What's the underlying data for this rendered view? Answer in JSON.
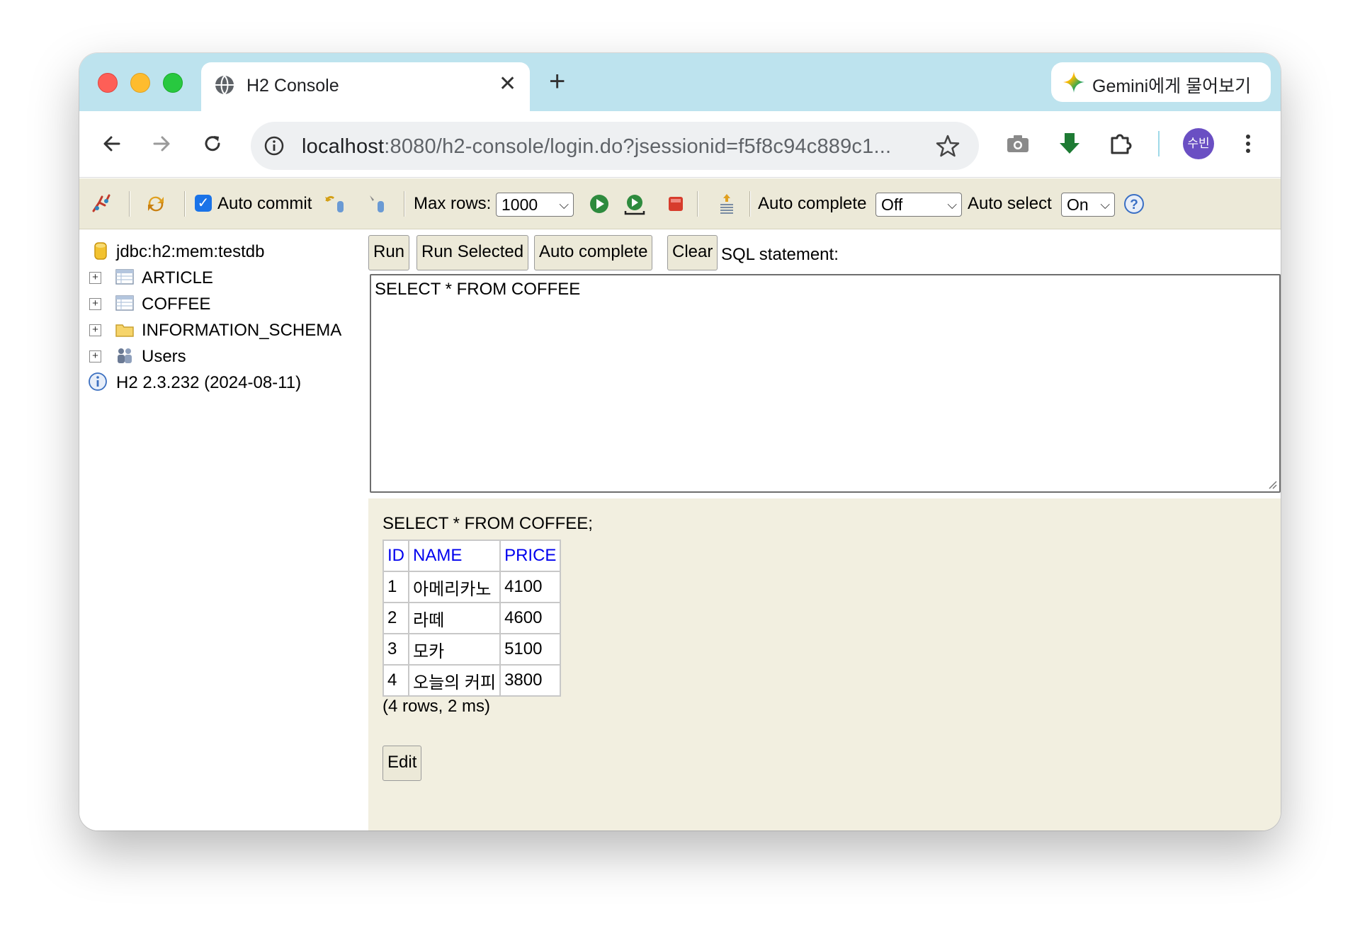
{
  "tab": {
    "title": "H2 Console",
    "close": "✕",
    "new_tab": "+"
  },
  "gemini": {
    "label": "Gemini에게 물어보기"
  },
  "address": {
    "host": "localhost",
    "rest": ":8080/h2-console/login.do?jsessionid=f5f8c94c889c1..."
  },
  "profile": {
    "initials": "수빈",
    "color": "#6a4fc3"
  },
  "h2toolbar": {
    "auto_commit_label": "Auto commit",
    "auto_commit_checked": true,
    "max_rows_label": "Max rows:",
    "max_rows_value": "1000",
    "auto_complete_label": "Auto complete",
    "auto_complete_value": "Off",
    "auto_select_label": "Auto select",
    "auto_select_value": "On"
  },
  "tree": {
    "connection": "jdbc:h2:mem:testdb",
    "items": [
      {
        "label": "ARTICLE",
        "icon": "table-icon"
      },
      {
        "label": "COFFEE",
        "icon": "table-icon"
      },
      {
        "label": "INFORMATION_SCHEMA",
        "icon": "folder-icon"
      },
      {
        "label": "Users",
        "icon": "users-icon"
      }
    ],
    "version": "H2 2.3.232 (2024-08-11)"
  },
  "buttons": {
    "run": "Run",
    "run_selected": "Run Selected",
    "auto_complete": "Auto complete",
    "clear": "Clear",
    "sql_label": "SQL statement:"
  },
  "editor": {
    "text": "SELECT * FROM COFFEE"
  },
  "results": {
    "query": "SELECT * FROM COFFEE;",
    "columns": [
      "ID",
      "NAME",
      "PRICE"
    ],
    "rows": [
      [
        "1",
        "아메리카노",
        "4100"
      ],
      [
        "2",
        "라떼",
        "4600"
      ],
      [
        "3",
        "모카",
        "5100"
      ],
      [
        "4",
        "오늘의 커피",
        "3800"
      ]
    ],
    "summary": "(4 rows, 2 ms)",
    "edit_label": "Edit"
  },
  "colors": {
    "tabstrip": "#bde3ee",
    "h2_toolbar": "#ece9d8",
    "result_bg": "#f2efe0",
    "link_blue": "#0000ee"
  }
}
